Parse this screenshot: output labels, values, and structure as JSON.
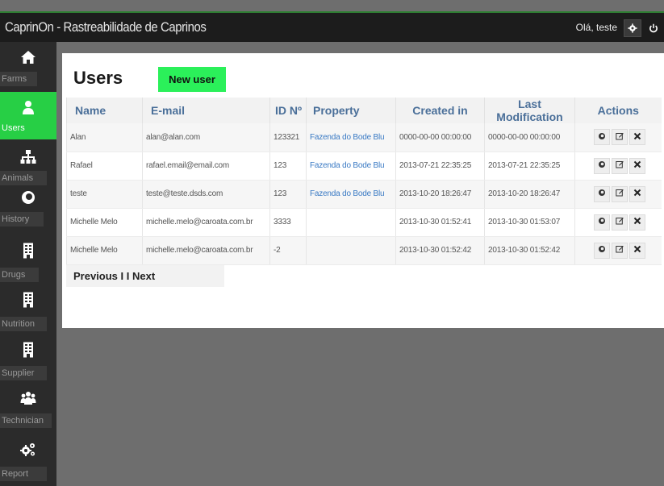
{
  "header": {
    "title": "CaprinOn - Rastreabilidade de Caprinos",
    "greeting": "Olá, teste",
    "icons": [
      "gear-icon",
      "power-icon"
    ]
  },
  "sidebar": {
    "items": [
      {
        "label": "Farms",
        "icon": "home-icon",
        "active": false
      },
      {
        "label": "Users",
        "icon": "user-icon",
        "active": true
      },
      {
        "label": "Animals",
        "icon": "sitemap-icon",
        "active": false
      },
      {
        "label": "History",
        "icon": "eye-icon",
        "active": false
      },
      {
        "label": "Drugs",
        "icon": "building-icon",
        "active": false
      },
      {
        "label": "Nutrition",
        "icon": "building-icon",
        "active": false
      },
      {
        "label": "Supplier",
        "icon": "building-icon",
        "active": false
      },
      {
        "label": "Technician",
        "icon": "group-icon",
        "active": false
      },
      {
        "label": "Report",
        "icon": "gears-icon",
        "active": false
      }
    ]
  },
  "main": {
    "title": "Users",
    "new_user_label": "New user",
    "columns": [
      "Name",
      "E-mail",
      "ID Nº",
      "Property",
      "Created in",
      "Last Modification",
      "Actions"
    ],
    "rows": [
      {
        "name": "Alan",
        "email": "alan@alan.com",
        "id": "123321",
        "property": "Fazenda do Bode Blu",
        "created": "0000-00-00 00:00:00",
        "modified": "0000-00-00 00:00:00"
      },
      {
        "name": "Rafael",
        "email": "rafael.email@email.com",
        "id": "123",
        "property": "Fazenda do Bode Blu",
        "created": "2013-07-21 22:35:25",
        "modified": "2013-07-21 22:35:25"
      },
      {
        "name": "teste",
        "email": "teste@teste.dsds.com",
        "id": "123",
        "property": "Fazenda do Bode Blu",
        "created": "2013-10-20 18:26:47",
        "modified": "2013-10-20 18:26:47"
      },
      {
        "name": "Michelle Melo",
        "email": "michelle.melo@caroata.com.br",
        "id": "3333",
        "property": "",
        "created": "2013-10-30 01:52:41",
        "modified": "2013-10-30 01:53:07"
      },
      {
        "name": "Michelle Melo",
        "email": "michelle.melo@caroata.com.br",
        "id": "-2",
        "property": "",
        "created": "2013-10-30 01:52:42",
        "modified": "2013-10-30 01:52:42"
      }
    ],
    "pagination": "Previous I I Next",
    "action_icons": [
      "eye-icon",
      "edit-icon",
      "delete-icon"
    ]
  },
  "colors": {
    "accent": "#27cf45",
    "new_user_button": "#2bf05a",
    "header_text": "#4a6f99",
    "link": "#3a7ac4",
    "topbar": "#1c1c1c",
    "sidebar": "#2b2b2b"
  }
}
